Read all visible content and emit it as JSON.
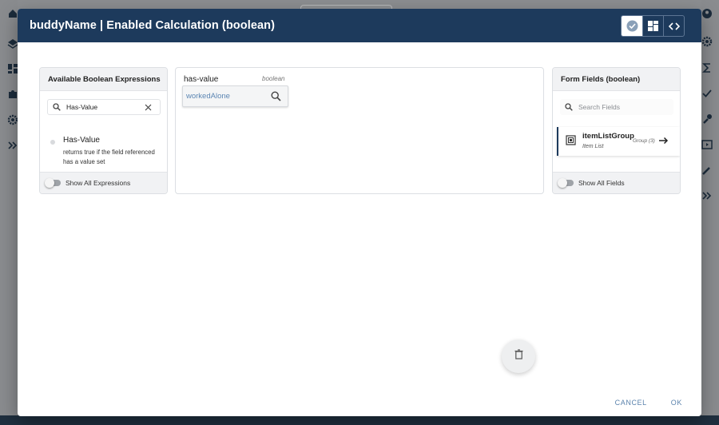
{
  "dialog": {
    "title": "buddyName | Enabled Calculation (boolean)",
    "header_buttons": [
      {
        "name": "check-icon",
        "active": true
      },
      {
        "name": "blocks-icon",
        "active": false
      },
      {
        "name": "code-icon",
        "active": false
      }
    ],
    "cancel_label": "CANCEL",
    "ok_label": "OK"
  },
  "left_panel": {
    "title": "Available Boolean Expressions",
    "search_value": "Has-Value",
    "expression": {
      "name": "Has-Value",
      "description": "returns true if the field referenced has a value set"
    },
    "footer_label": "Show All Expressions"
  },
  "center_panel": {
    "expression_label": "has-value",
    "type_label": "boolean",
    "field_value": "workedAlone"
  },
  "right_panel": {
    "title": "Form Fields (boolean)",
    "search_placeholder": "Search Fields",
    "field": {
      "name": "itemListGroup",
      "subtitle": "Item List",
      "badge": "Group (3)"
    },
    "footer_label": "Show All Fields"
  },
  "colors": {
    "header": "#1d3a5c",
    "accent": "#5b83ad",
    "overlay": "#7d7f82"
  }
}
